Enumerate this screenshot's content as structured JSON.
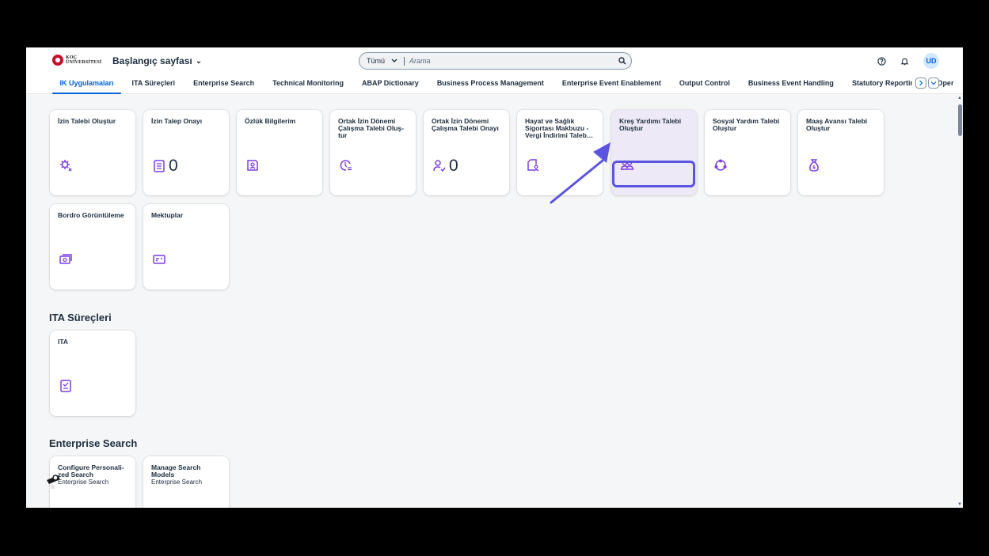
{
  "header": {
    "logo_text_line1": "KOÇ",
    "logo_text_line2": "ÜNİVERSİTESİ",
    "home_title": "Başlangıç sayfası",
    "search_scope": "Tümü",
    "search_placeholder": "Arama",
    "avatar_initials": "UD"
  },
  "tabs": [
    {
      "label": "IK Uygulamaları",
      "active": true
    },
    {
      "label": "ITA Süreçleri"
    },
    {
      "label": "Enterprise Search"
    },
    {
      "label": "Technical Monitoring"
    },
    {
      "label": "ABAP Dictionary"
    },
    {
      "label": "Business Process Management"
    },
    {
      "label": "Enterprise Event Enablement"
    },
    {
      "label": "Output Control"
    },
    {
      "label": "Business Event Handling"
    },
    {
      "label": "Statutory Reporting"
    },
    {
      "label": "Oper"
    }
  ],
  "groups": {
    "ik": {
      "tiles": [
        {
          "title": "İzin Talebi Oluştur",
          "icon": "settings-person-icon"
        },
        {
          "title": "İzin Talep Onayı",
          "icon": "clipboard-check-icon",
          "kpi": "0"
        },
        {
          "title": "Özlük Bilgilerim",
          "icon": "id-card-icon"
        },
        {
          "title": "Ortak İzin Dönemi Çalışma Talebi Oluş-tur",
          "icon": "clock-list-icon"
        },
        {
          "title": "Ortak İzin Dönemi Çalışma Talebi Onayı",
          "icon": "user-approve-icon",
          "kpi": "0"
        },
        {
          "title": "Hayat ve Sağlık Sigortası Makbuzu - Vergi İndirimi Taleb…",
          "icon": "document-person-icon"
        },
        {
          "title": "Kreş Yardımı Talebi Oluştur",
          "icon": "group-icon"
        },
        {
          "title": "Sosyal Yardım Talebi Oluştur",
          "icon": "people-cycle-icon"
        },
        {
          "title": "Maaş Avansı Talebi Oluştur",
          "icon": "money-bag-icon"
        },
        {
          "title": "Bordro Görüntüleme",
          "icon": "money-bills-icon"
        },
        {
          "title": "Mektuplar",
          "icon": "card-icon"
        }
      ]
    },
    "ita": {
      "title": "ITA Süreçleri",
      "tiles": [
        {
          "title": "ITA",
          "icon": "clipboard-check-icon"
        }
      ]
    },
    "es": {
      "title": "Enterprise Search",
      "tiles": [
        {
          "title": "Configure Personali-zed Search",
          "subtitle": "Enterprise Search"
        },
        {
          "title": "Manage Search Models",
          "subtitle": "Enterprise Search"
        }
      ]
    }
  },
  "colors": {
    "accent": "#0064d9",
    "icon": "#7b3fe4",
    "highlight": "#5b54e0"
  }
}
